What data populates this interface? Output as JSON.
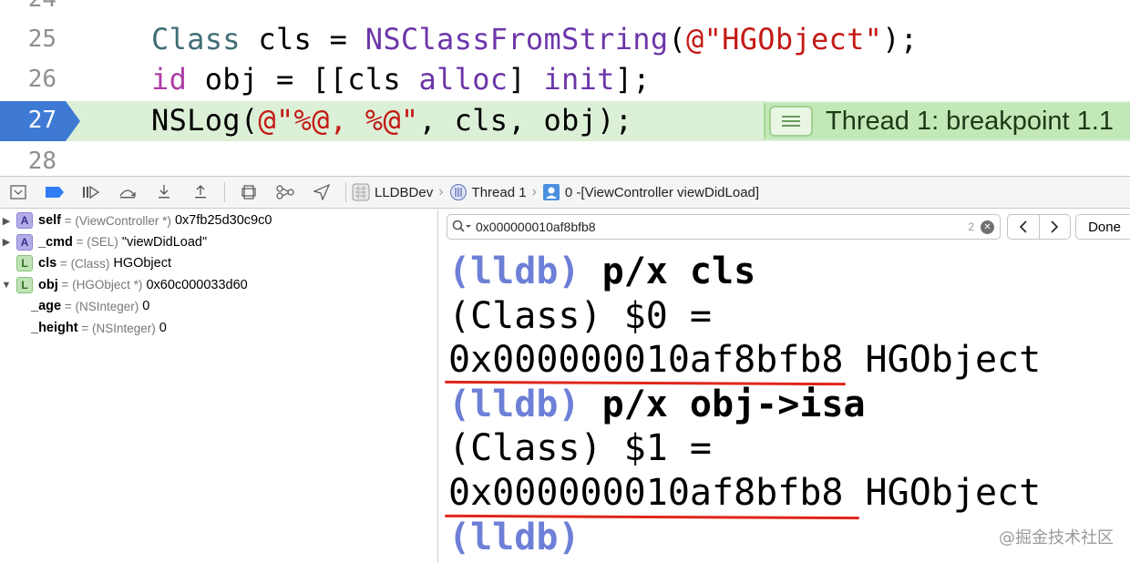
{
  "editor": {
    "partial_line_number": "24",
    "lines": [
      {
        "number": "25",
        "tokens": [
          [
            "type",
            "Class"
          ],
          [
            "plain",
            " cls = "
          ],
          [
            "func",
            "NSClassFromString"
          ],
          [
            "plain",
            "("
          ],
          [
            "str",
            "@\"HGObject\""
          ],
          [
            "plain",
            ");"
          ]
        ]
      },
      {
        "number": "26",
        "tokens": [
          [
            "kw",
            "id"
          ],
          [
            "plain",
            " obj = [[cls "
          ],
          [
            "func",
            "alloc"
          ],
          [
            "plain",
            "] "
          ],
          [
            "func",
            "init"
          ],
          [
            "plain",
            "];"
          ]
        ]
      },
      {
        "number": "27",
        "tokens": [
          [
            "plain",
            "NSLog("
          ],
          [
            "str",
            "@\"%@, %@\""
          ],
          [
            "plain",
            ", cls, obj);"
          ]
        ]
      },
      {
        "number": "28",
        "tokens": []
      }
    ],
    "current_line": "27",
    "breakpoint_banner": "Thread 1: breakpoint 1.1"
  },
  "debug_bar": {
    "breadcrumbs": [
      "LLDBDev",
      "Thread 1",
      "0 -[ViewController viewDidLoad]"
    ]
  },
  "variables": [
    {
      "disclosure": "▶",
      "badge": "A",
      "name": "self",
      "type": "(ViewController *)",
      "value": "0x7fb25d30c9c0"
    },
    {
      "disclosure": "▶",
      "badge": "A",
      "name": "_cmd",
      "type": "(SEL)",
      "value": "\"viewDidLoad\""
    },
    {
      "disclosure": "",
      "badge": "L",
      "name": "cls",
      "type": "(Class)",
      "value": "HGObject"
    },
    {
      "disclosure": "▼",
      "badge": "L",
      "name": "obj",
      "type": "(HGObject *)",
      "value": "0x60c000033d60"
    },
    {
      "disclosure": "",
      "badge": "",
      "name": "_age",
      "type": "(NSInteger)",
      "value": "0"
    },
    {
      "disclosure": "",
      "badge": "",
      "name": "_height",
      "type": "(NSInteger)",
      "value": "0"
    }
  ],
  "console": {
    "find": {
      "query": "0x000000010af8bfb8",
      "match_count": "2",
      "done_label": "Done"
    },
    "lines": [
      {
        "prompt": "(lldb)",
        "command": " p/x cls",
        "text": ""
      },
      {
        "prompt": "",
        "command": "",
        "text": "(Class) $0 ="
      },
      {
        "prompt": "",
        "command": "",
        "text": "0x000000010af8bfb8 HGObject"
      },
      {
        "prompt": "(lldb)",
        "command": " p/x obj->isa",
        "text": ""
      },
      {
        "prompt": "",
        "command": "",
        "text": "(Class) $1 ="
      },
      {
        "prompt": "",
        "command": "",
        "text": "0x000000010af8bfb8 HGObject"
      },
      {
        "prompt": "(lldb)",
        "command": "",
        "text": ""
      }
    ]
  },
  "watermark": "@掘金技术社区",
  "colors": {
    "current_line_bg": "#dbf0d7",
    "breakpoint_blue": "#3e7ad4",
    "lldb_prompt": "#6d7fd6",
    "underline_red": "#e0261b"
  }
}
